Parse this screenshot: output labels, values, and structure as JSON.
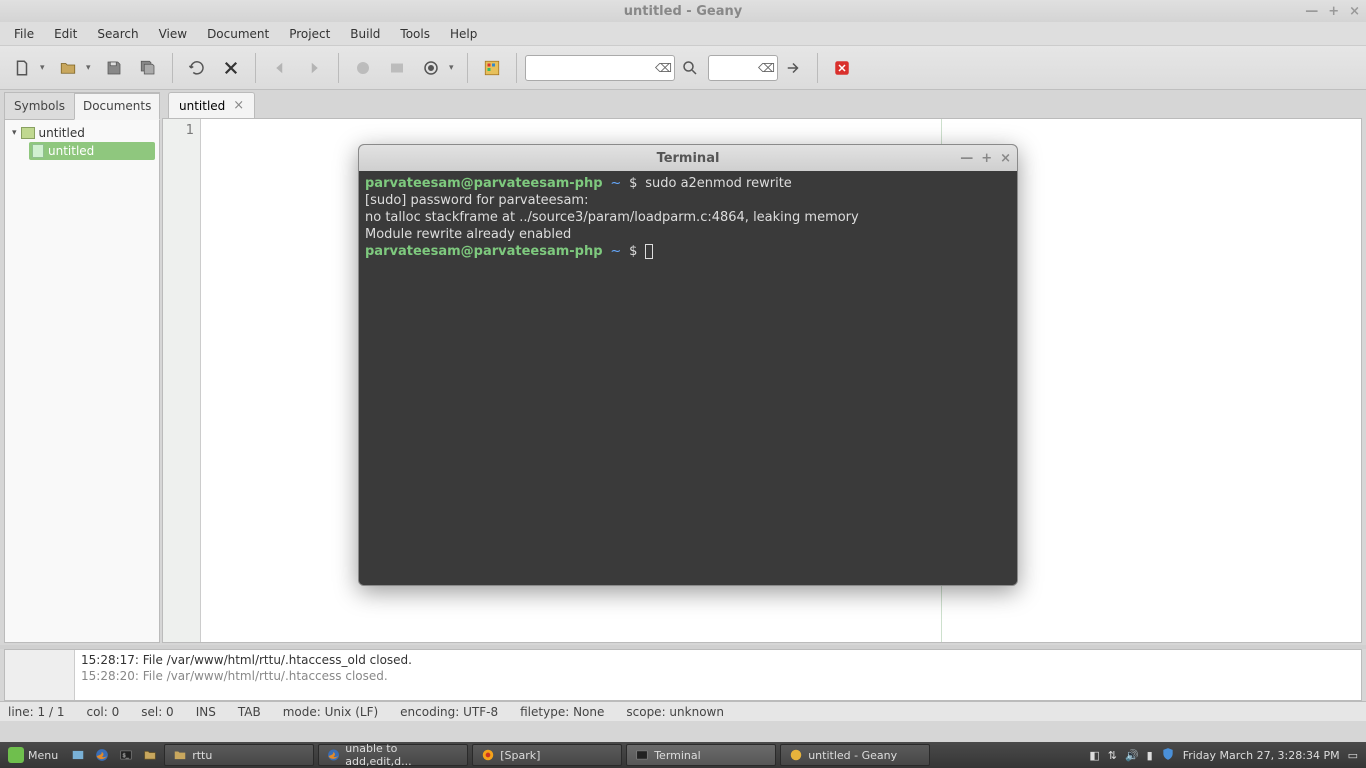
{
  "window": {
    "title": "untitled - Geany"
  },
  "menus": [
    "File",
    "Edit",
    "Search",
    "View",
    "Document",
    "Project",
    "Build",
    "Tools",
    "Help"
  ],
  "sidebar": {
    "tabs": [
      "Symbols",
      "Documents"
    ],
    "active_tab": 1,
    "root": "untitled",
    "selected": "untitled"
  },
  "doctab": {
    "label": "untitled"
  },
  "gutter": {
    "line1": "1"
  },
  "messages": {
    "side_label": "",
    "line0": "",
    "line1": "15:28:17: File /var/www/html/rttu/.htaccess_old closed.",
    "line2": "15:28:20: File /var/www/html/rttu/.htaccess closed."
  },
  "status": {
    "line": "line: 1 / 1",
    "col": "col: 0",
    "sel": "sel: 0",
    "ins": "INS",
    "tab": "TAB",
    "mode": "mode: Unix (LF)",
    "enc": "encoding: UTF-8",
    "ftype": "filetype: None",
    "scope": "scope: unknown"
  },
  "terminal": {
    "title": "Terminal",
    "prompt_user": "parvateesam@parvateesam-php",
    "prompt_path": "~",
    "prompt_sym": "$",
    "cmd1": "sudo a2enmod rewrite",
    "out1": "[sudo] password for parvateesam:",
    "out2": "no talloc stackframe at ../source3/param/loadparm.c:4864, leaking memory",
    "out3": "Module rewrite already enabled"
  },
  "taskbar": {
    "menu": "Menu",
    "apps": [
      {
        "label": "rttu"
      },
      {
        "label": "unable to add,edit,d..."
      },
      {
        "label": "[Spark]"
      },
      {
        "label": "Terminal"
      },
      {
        "label": "untitled - Geany"
      }
    ],
    "clock": "Friday March 27,   3:28:34 PM"
  }
}
